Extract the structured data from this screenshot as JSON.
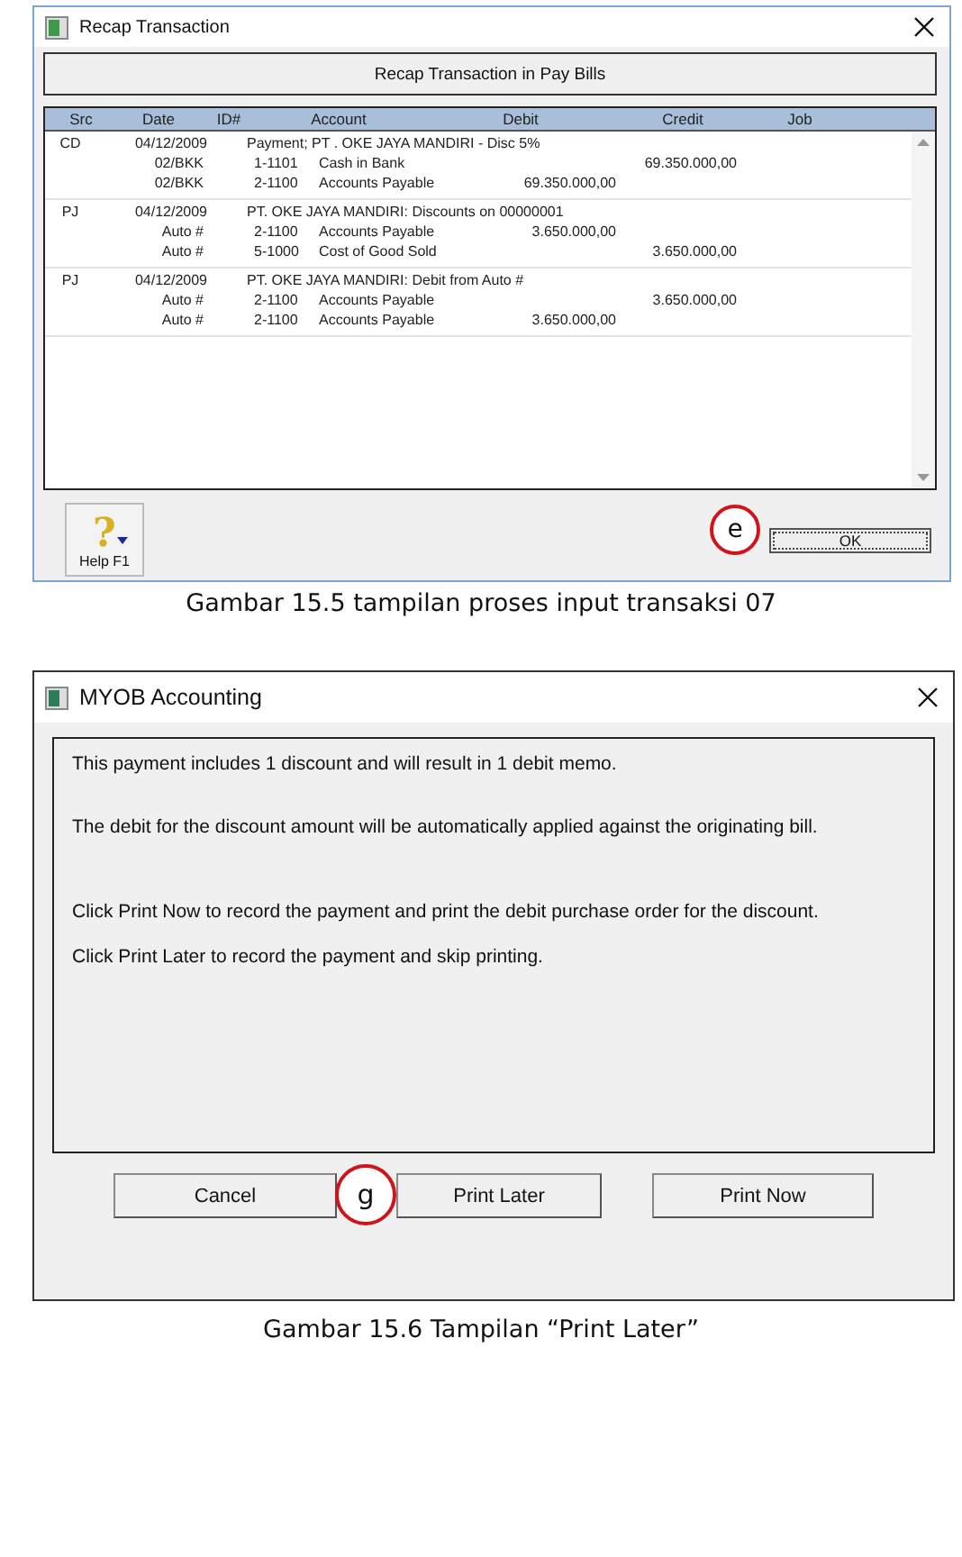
{
  "figures": [
    {
      "window": {
        "title": "Recap Transaction"
      },
      "header": "Recap Transaction in Pay Bills",
      "columns": [
        "Src",
        "Date",
        "ID#",
        "Account",
        "Debit",
        "Credit",
        "Job"
      ],
      "groups": [
        {
          "src": "CD",
          "date": "04/12/2009",
          "memo": "Payment; PT . OKE JAYA MANDIRI - Disc 5%",
          "lines": [
            {
              "id": "02/BKK",
              "code": "1-1101",
              "account": "Cash in Bank",
              "credit": "69.350.000,00"
            },
            {
              "id": "02/BKK",
              "code": "2-1100",
              "account": "Accounts Payable",
              "debit": "69.350.000,00"
            }
          ]
        },
        {
          "src": "PJ",
          "date": "04/12/2009",
          "memo": "PT. OKE JAYA MANDIRI:  Discounts on 00000001",
          "lines": [
            {
              "id": "Auto #",
              "code": "2-1100",
              "account": "Accounts Payable",
              "debit": "3.650.000,00"
            },
            {
              "id": "Auto #",
              "code": "5-1000",
              "account": "Cost of Good Sold",
              "credit": "3.650.000,00"
            }
          ]
        },
        {
          "src": "PJ",
          "date": "04/12/2009",
          "memo": "PT. OKE JAYA MANDIRI:  Debit from Auto #",
          "lines": [
            {
              "id": "Auto #",
              "code": "2-1100",
              "account": "Accounts Payable",
              "credit": "3.650.000,00"
            },
            {
              "id": "Auto #",
              "code": "2-1100",
              "account": "Accounts Payable",
              "debit": "3.650.000,00"
            }
          ]
        }
      ],
      "help_button": {
        "icon": "?",
        "label": "Help F1"
      },
      "marker": "e",
      "ok_button": "OK",
      "caption": "Gambar 15.5 tampilan proses input transaksi 07"
    },
    {
      "window": {
        "title": "MYOB Accounting"
      },
      "paragraphs": [
        "This payment includes 1 discount and will result in 1 debit memo.",
        "The debit for the discount amount will be automatically applied against the originating bill.",
        "Click Print Now to record the payment and print the debit purchase order for the discount.",
        "Click Print Later to record the payment and skip printing."
      ],
      "buttons": [
        "Cancel",
        "Print Later",
        "Print Now"
      ],
      "marker": "g",
      "caption": "Gambar 15.6 Tampilan “Print Later”"
    }
  ]
}
